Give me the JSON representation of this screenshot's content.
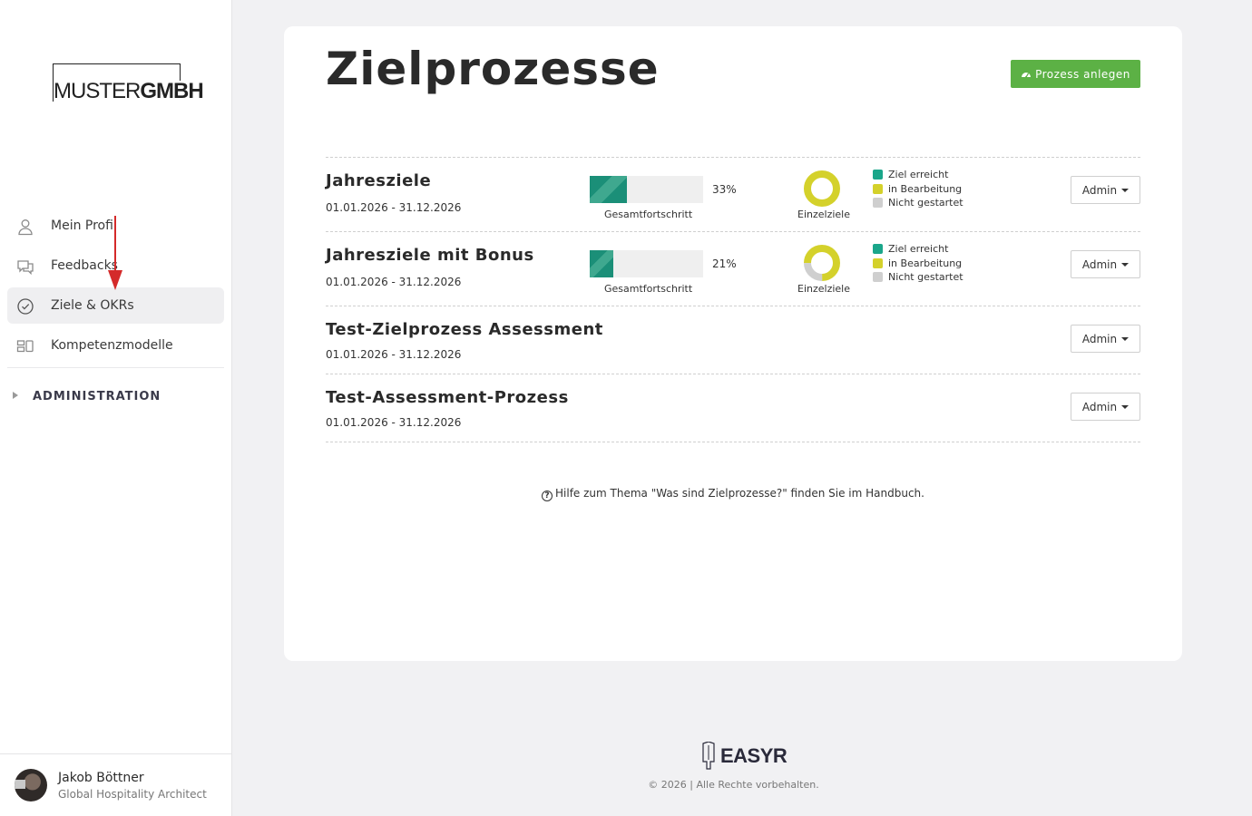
{
  "brand": {
    "logo_light": "MUSTER",
    "logo_bold": "GMBH"
  },
  "sidebar": {
    "items": [
      {
        "label": "Mein Profil",
        "icon": "user-icon",
        "active": false
      },
      {
        "label": "Feedbacks",
        "icon": "chat-icon",
        "active": false
      },
      {
        "label": "Ziele & OKRs",
        "icon": "check-circle-icon",
        "active": true
      },
      {
        "label": "Kompetenzmodelle",
        "icon": "modules-icon",
        "active": false
      }
    ],
    "admin_label": "ADMINISTRATION",
    "user": {
      "name": "Jakob Böttner",
      "role": "Global Hospitality Architect"
    }
  },
  "main": {
    "title": "Zielprozesse",
    "create_button": "Prozess anlegen",
    "processes": [
      {
        "title": "Jahresziele",
        "date": "01.01.2026 - 31.12.2026",
        "progress": 33,
        "progress_text": "33%",
        "progress_label": "Gesamtfortschritt",
        "donut_label": "Einzelziele",
        "donut": {
          "reached": 0,
          "in_progress": 100,
          "not_started": 0
        },
        "admin": "Admin"
      },
      {
        "title": "Jahresziele mit Bonus",
        "date": "01.01.2026 - 31.12.2026",
        "progress": 21,
        "progress_text": "21%",
        "progress_label": "Gesamtfortschritt",
        "donut_label": "Einzelziele",
        "donut": {
          "reached": 0,
          "in_progress": 75,
          "not_started": 25
        },
        "admin": "Admin"
      },
      {
        "title": "Test-Zielprozess Assessment",
        "date": "01.01.2026 - 31.12.2026",
        "admin": "Admin"
      },
      {
        "title": "Test-Assessment-Prozess",
        "date": "01.01.2026 - 31.12.2026",
        "admin": "Admin"
      }
    ],
    "legend": [
      {
        "label": "Ziel erreicht",
        "color": "#1aa68a"
      },
      {
        "label": "in Bearbeitung",
        "color": "#d4d12b"
      },
      {
        "label": "Nicht gestartet",
        "color": "#cfcfcf"
      }
    ],
    "help_text": "Hilfe zum Thema \"Was sind Zielprozesse?\" finden Sie im Handbuch."
  },
  "footer": {
    "logo_text": "EASYR",
    "copyright": "© 2026 | Alle Rechte vorbehalten."
  },
  "colors": {
    "accent_green": "#5cb145",
    "progress_teal": "#1b8f78",
    "donut_yellow": "#d4d12b",
    "donut_grey": "#cfcfcf",
    "annotation_red": "#d42a2a"
  }
}
